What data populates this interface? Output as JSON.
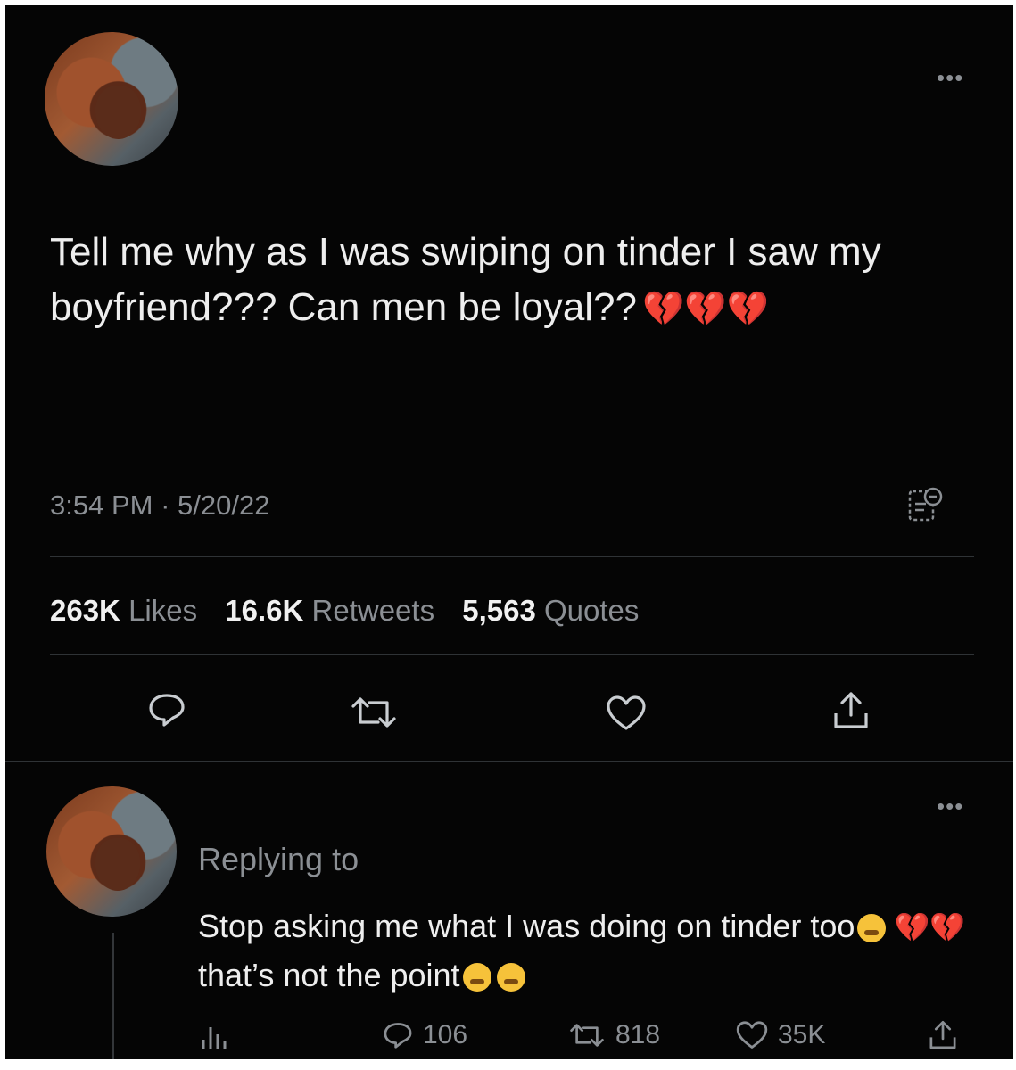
{
  "main_tweet": {
    "text": "Tell me why as I was swiping on tinder I saw my boyfriend??? Can men be loyal??",
    "emoji": "💔💔💔",
    "time": "3:54 PM",
    "separator": "·",
    "date": "5/20/22",
    "stats": {
      "likes_count": "263K",
      "likes_label": "Likes",
      "retweets_count": "16.6K",
      "retweets_label": "Retweets",
      "quotes_count": "5,563",
      "quotes_label": "Quotes"
    }
  },
  "reply_tweet": {
    "replying_to": "Replying to",
    "text_part1": "Stop asking me what I was doing on tinder too",
    "emoji_part1": "💔💔",
    "text_part2": "that’s not the point",
    "counts": {
      "replies": "106",
      "retweets": "818",
      "likes": "35K"
    }
  },
  "icons": [
    "more-icon",
    "analytics-icon",
    "reply-icon",
    "retweet-icon",
    "like-icon",
    "share-icon",
    "views-icon"
  ],
  "colors": {
    "background": "#050505",
    "text": "#e7e9ea",
    "muted": "#8b8f94",
    "broken_heart": "#e0245e"
  }
}
